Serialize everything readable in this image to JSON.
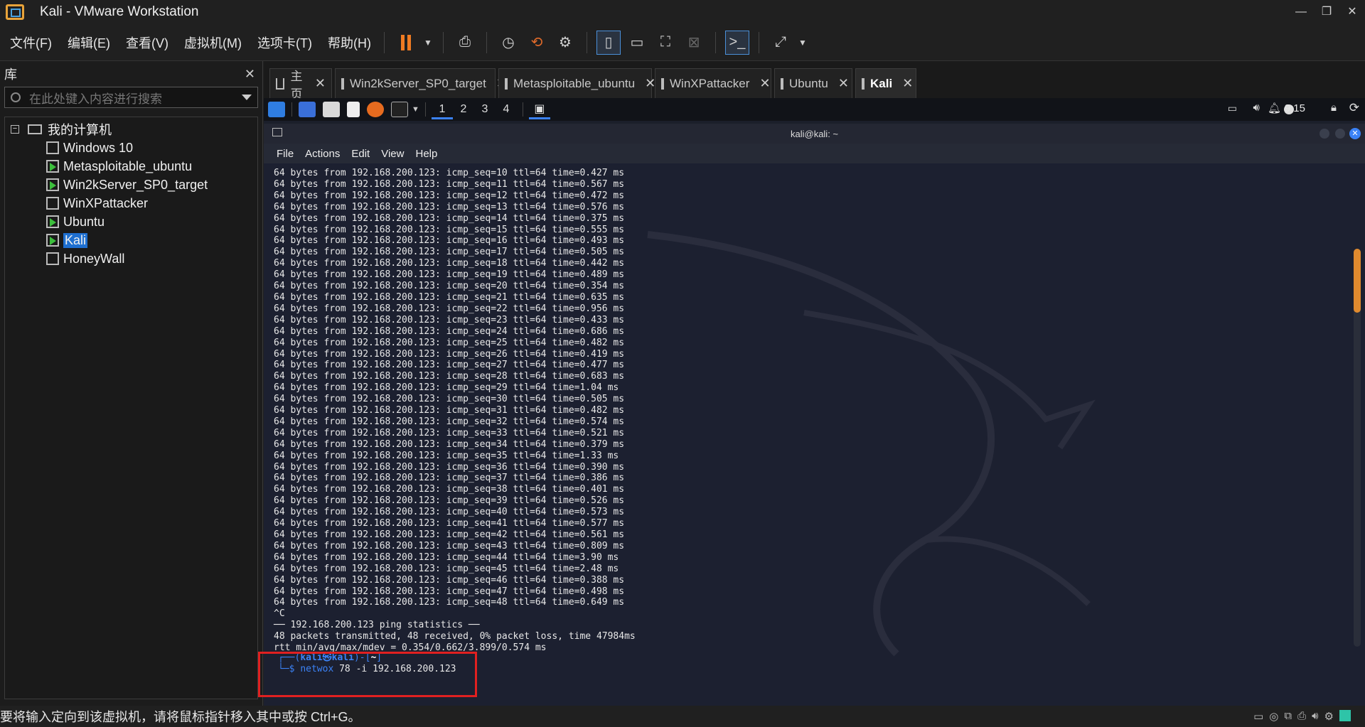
{
  "window": {
    "title": "Kali - VMware Workstation"
  },
  "menu": [
    "文件(F)",
    "编辑(E)",
    "查看(V)",
    "虚拟机(M)",
    "选项卡(T)",
    "帮助(H)"
  ],
  "library": {
    "title": "库",
    "search_placeholder": "在此处键入内容进行搜索",
    "root": "我的计算机",
    "vms": [
      {
        "name": "Windows 10",
        "running": false,
        "selected": false
      },
      {
        "name": "Metasploitable_ubuntu",
        "running": true,
        "selected": false
      },
      {
        "name": "Win2kServer_SP0_target",
        "running": true,
        "selected": false
      },
      {
        "name": "WinXPattacker",
        "running": false,
        "selected": false
      },
      {
        "name": "Ubuntu",
        "running": true,
        "selected": false
      },
      {
        "name": "Kali",
        "running": true,
        "selected": true
      },
      {
        "name": "HoneyWall",
        "running": false,
        "selected": false
      }
    ]
  },
  "tabs": [
    {
      "label": "主页",
      "active": false
    },
    {
      "label": "Win2kServer_SP0_target",
      "active": false
    },
    {
      "label": "Metasploitable_ubuntu",
      "active": false
    },
    {
      "label": "WinXPattacker",
      "active": false
    },
    {
      "label": "Ubuntu",
      "active": false
    },
    {
      "label": "Kali",
      "active": true
    }
  ],
  "guest_panel": {
    "workspaces": [
      "1",
      "2",
      "3",
      "4"
    ],
    "clock": "9:15"
  },
  "terminal": {
    "title": "kali@kali: ~",
    "menu": [
      "File",
      "Actions",
      "Edit",
      "View",
      "Help"
    ],
    "ping_lines": [
      "64 bytes from 192.168.200.123: icmp_seq=10 ttl=64 time=0.427 ms",
      "64 bytes from 192.168.200.123: icmp_seq=11 ttl=64 time=0.567 ms",
      "64 bytes from 192.168.200.123: icmp_seq=12 ttl=64 time=0.472 ms",
      "64 bytes from 192.168.200.123: icmp_seq=13 ttl=64 time=0.576 ms",
      "64 bytes from 192.168.200.123: icmp_seq=14 ttl=64 time=0.375 ms",
      "64 bytes from 192.168.200.123: icmp_seq=15 ttl=64 time=0.555 ms",
      "64 bytes from 192.168.200.123: icmp_seq=16 ttl=64 time=0.493 ms",
      "64 bytes from 192.168.200.123: icmp_seq=17 ttl=64 time=0.505 ms",
      "64 bytes from 192.168.200.123: icmp_seq=18 ttl=64 time=0.442 ms",
      "64 bytes from 192.168.200.123: icmp_seq=19 ttl=64 time=0.489 ms",
      "64 bytes from 192.168.200.123: icmp_seq=20 ttl=64 time=0.354 ms",
      "64 bytes from 192.168.200.123: icmp_seq=21 ttl=64 time=0.635 ms",
      "64 bytes from 192.168.200.123: icmp_seq=22 ttl=64 time=0.956 ms",
      "64 bytes from 192.168.200.123: icmp_seq=23 ttl=64 time=0.433 ms",
      "64 bytes from 192.168.200.123: icmp_seq=24 ttl=64 time=0.686 ms",
      "64 bytes from 192.168.200.123: icmp_seq=25 ttl=64 time=0.482 ms",
      "64 bytes from 192.168.200.123: icmp_seq=26 ttl=64 time=0.419 ms",
      "64 bytes from 192.168.200.123: icmp_seq=27 ttl=64 time=0.477 ms",
      "64 bytes from 192.168.200.123: icmp_seq=28 ttl=64 time=0.683 ms",
      "64 bytes from 192.168.200.123: icmp_seq=29 ttl=64 time=1.04 ms",
      "64 bytes from 192.168.200.123: icmp_seq=30 ttl=64 time=0.505 ms",
      "64 bytes from 192.168.200.123: icmp_seq=31 ttl=64 time=0.482 ms",
      "64 bytes from 192.168.200.123: icmp_seq=32 ttl=64 time=0.574 ms",
      "64 bytes from 192.168.200.123: icmp_seq=33 ttl=64 time=0.521 ms",
      "64 bytes from 192.168.200.123: icmp_seq=34 ttl=64 time=0.379 ms",
      "64 bytes from 192.168.200.123: icmp_seq=35 ttl=64 time=1.33 ms",
      "64 bytes from 192.168.200.123: icmp_seq=36 ttl=64 time=0.390 ms",
      "64 bytes from 192.168.200.123: icmp_seq=37 ttl=64 time=0.386 ms",
      "64 bytes from 192.168.200.123: icmp_seq=38 ttl=64 time=0.401 ms",
      "64 bytes from 192.168.200.123: icmp_seq=39 ttl=64 time=0.526 ms",
      "64 bytes from 192.168.200.123: icmp_seq=40 ttl=64 time=0.573 ms",
      "64 bytes from 192.168.200.123: icmp_seq=41 ttl=64 time=0.577 ms",
      "64 bytes from 192.168.200.123: icmp_seq=42 ttl=64 time=0.561 ms",
      "64 bytes from 192.168.200.123: icmp_seq=43 ttl=64 time=0.809 ms",
      "64 bytes from 192.168.200.123: icmp_seq=44 ttl=64 time=3.90 ms",
      "64 bytes from 192.168.200.123: icmp_seq=45 ttl=64 time=2.48 ms",
      "64 bytes from 192.168.200.123: icmp_seq=46 ttl=64 time=0.388 ms",
      "64 bytes from 192.168.200.123: icmp_seq=47 ttl=64 time=0.498 ms",
      "64 bytes from 192.168.200.123: icmp_seq=48 ttl=64 time=0.649 ms",
      "^C",
      "── 192.168.200.123 ping statistics ──",
      "48 packets transmitted, 48 received, 0% packet loss, time 47984ms",
      "rtt min/avg/max/mdev = 0.354/0.662/3.899/0.574 ms"
    ],
    "prompt_user": "kali",
    "prompt_host": "kali",
    "prompt_dir": "~",
    "command_name": "netwox",
    "command_args": " 78 -i 192.168.200.123"
  },
  "status": {
    "message": "要将输入定向到该虚拟机，请将鼠标指针移入其中或按 Ctrl+G。"
  },
  "colors": {
    "accent": "#1e6fd0",
    "pause": "#f07b22",
    "highlight": "#e02020",
    "prompt_blue": "#3b82f6"
  }
}
